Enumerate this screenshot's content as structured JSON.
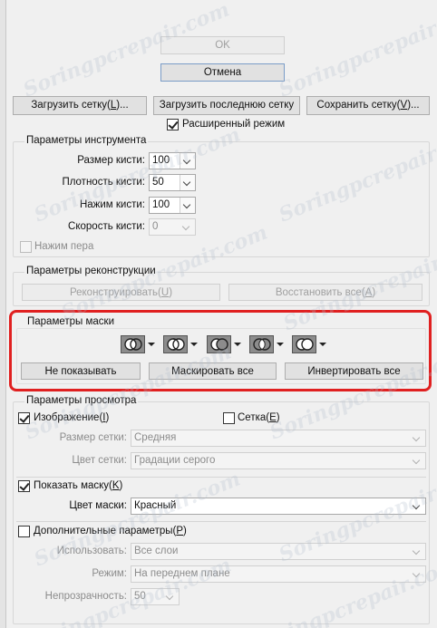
{
  "dialog": {
    "ok_label": "OK",
    "cancel_label": "Отмена",
    "load_mesh_label": "Загрузить сетку(",
    "load_mesh_key": "L",
    "load_mesh_tail": ")...",
    "load_last_mesh_label": "Загрузить последнюю сетку",
    "save_mesh_label": "Сохранить сетку(",
    "save_mesh_key": "V",
    "save_mesh_tail": ")...",
    "advanced_mode_label": "Расширенный режим",
    "advanced_mode_checked": true
  },
  "tool_options": {
    "legend": "Параметры инструмента",
    "brush_size_label": "Размер кисти:",
    "brush_size_value": "100",
    "brush_density_label": "Плотность кисти:",
    "brush_density_value": "50",
    "brush_pressure_label": "Нажим кисти:",
    "brush_pressure_value": "100",
    "brush_rate_label": "Скорость кисти:",
    "brush_rate_value": "0",
    "stylus_pressure_label": "Нажим пера",
    "stylus_pressure_checked": false
  },
  "reconstruct_options": {
    "legend": "Параметры реконструкции",
    "reconstruct_label": "Реконструировать(",
    "reconstruct_key": "U",
    "reconstruct_tail": ")",
    "restore_all_label": "Восстановить все(",
    "restore_all_key": "A",
    "restore_all_tail": ")"
  },
  "mask_options": {
    "legend": "Параметры маски",
    "mask_modes": [
      "replace-selection-icon",
      "add-to-selection-icon",
      "subtract-from-selection-icon",
      "intersect-with-selection-icon",
      "invert-selection-icon"
    ],
    "none_label": "Не показывать",
    "mask_all_label": "Маскировать все",
    "invert_all_label": "Инвертировать все"
  },
  "view_options": {
    "legend": "Параметры просмотра",
    "show_image_label": "Изображение(",
    "show_image_key": "I",
    "show_image_tail": ")",
    "show_image_checked": true,
    "show_mesh_label": "Сетка(",
    "show_mesh_key": "E",
    "show_mesh_tail": ")",
    "show_mesh_checked": false,
    "mesh_size_label": "Размер сетки:",
    "mesh_size_value": "Средняя",
    "mesh_color_label": "Цвет сетки:",
    "mesh_color_value": "Градации серого",
    "show_mask_label": "Показать маску(",
    "show_mask_key": "K",
    "show_mask_tail": ")",
    "show_mask_checked": true,
    "mask_color_label": "Цвет маски:",
    "mask_color_value": "Красный",
    "backdrop_label": "Дополнительные параметры(",
    "backdrop_key": "P",
    "backdrop_tail": ")",
    "backdrop_checked": false,
    "use_label": "Использовать:",
    "use_value": "Все слои",
    "mode_label": "Режим:",
    "mode_value": "На переднем плане",
    "opacity_label": "Непрозрачность:",
    "opacity_value": "50"
  },
  "watermark": "Soringpcrepair.com",
  "colors": {
    "highlight_box": "#e02020",
    "dialog_bg": "#f0f0f0"
  }
}
